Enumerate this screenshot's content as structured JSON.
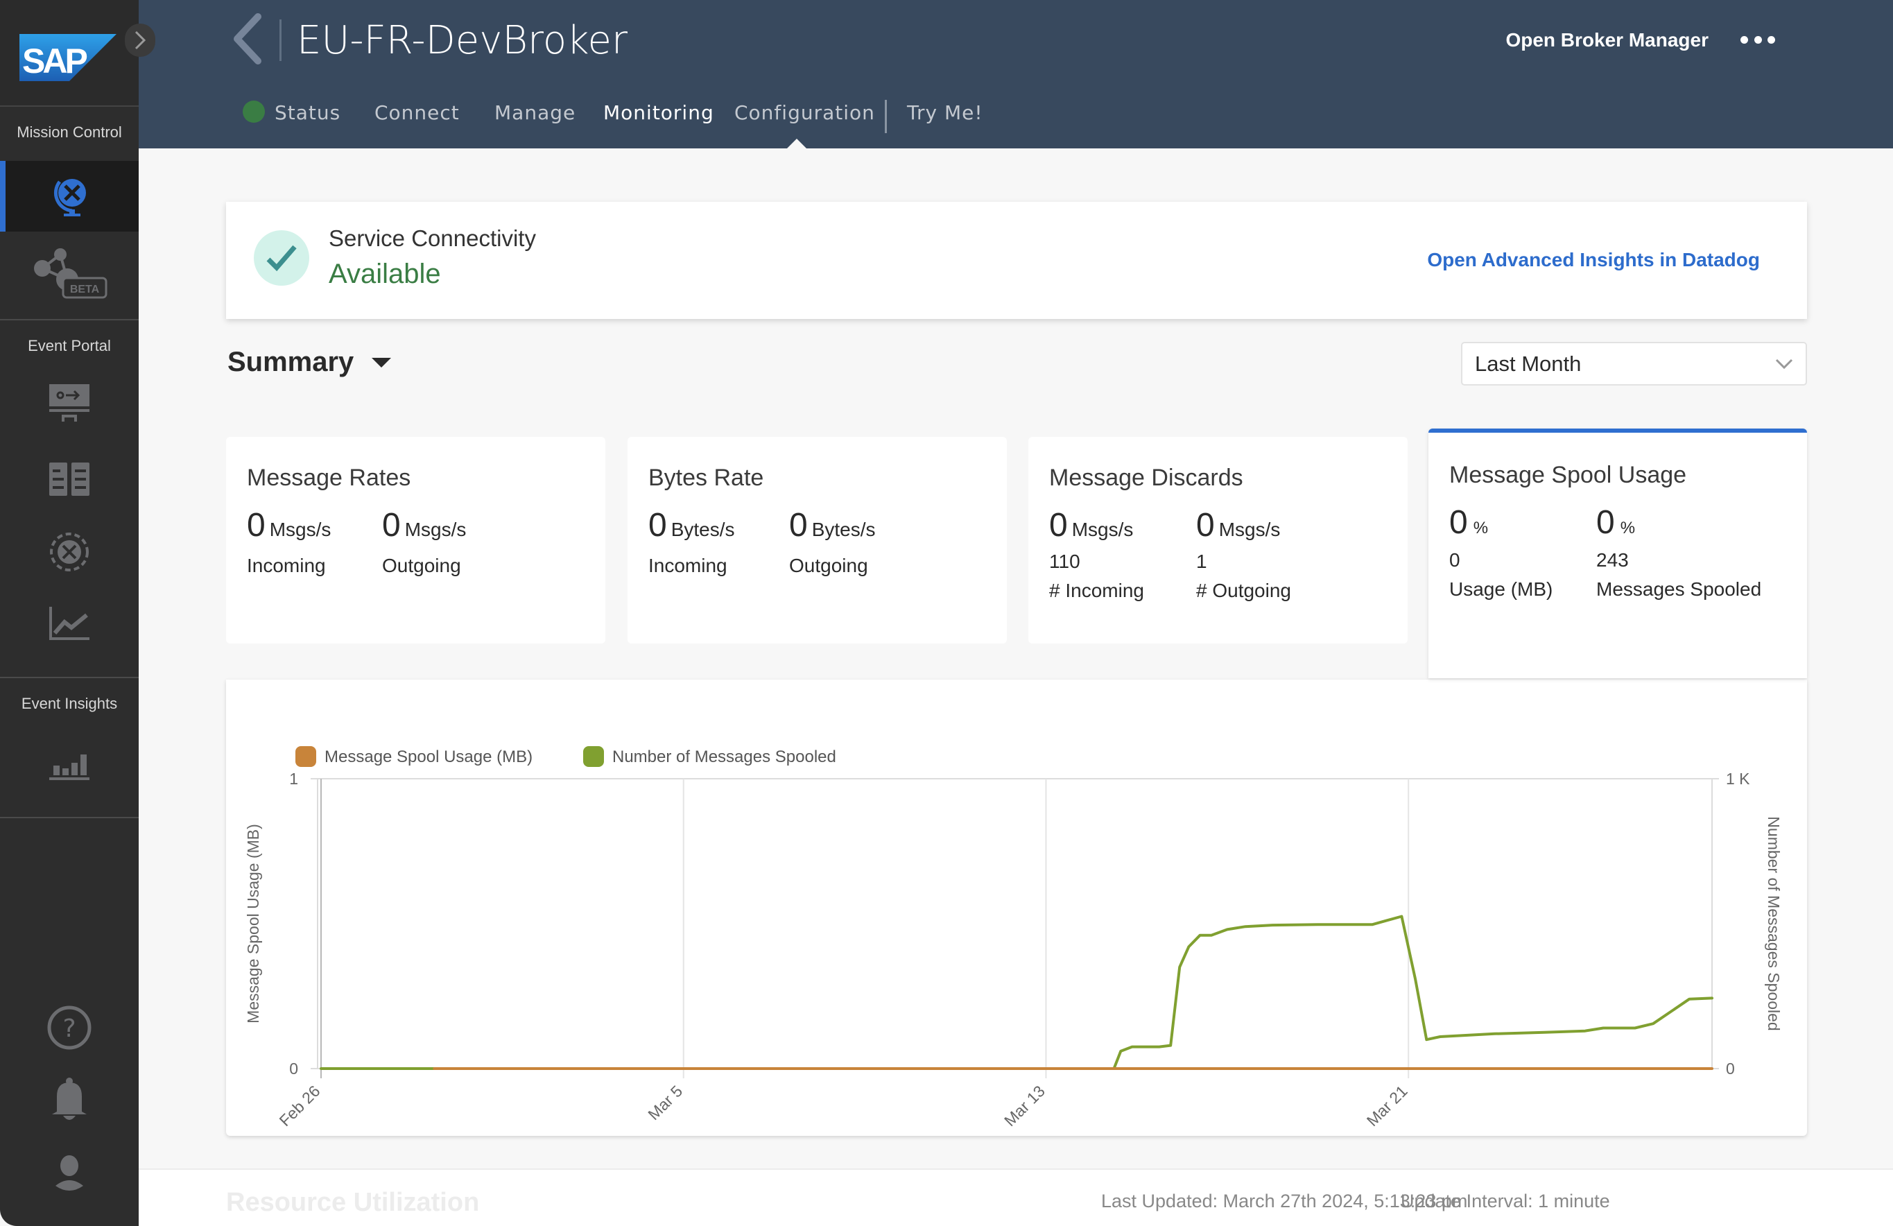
{
  "app": {
    "logo": "SAP",
    "expand_icon": "chevron-right-icon"
  },
  "sidebar": {
    "sections": [
      {
        "label": "Mission Control",
        "items": [
          {
            "name": "cluster-manager",
            "icon": "globe-icon",
            "active": true
          },
          {
            "name": "mesh-manager",
            "icon": "network-beta-icon",
            "badge": "BETA",
            "active": false
          }
        ]
      },
      {
        "label": "Event Portal",
        "items": [
          {
            "name": "designer",
            "icon": "designer-icon",
            "active": false
          },
          {
            "name": "catalog",
            "icon": "catalog-icon",
            "active": false
          },
          {
            "name": "runtime-event-manager",
            "icon": "runtime-globe-icon",
            "active": false
          },
          {
            "name": "event-portal-insights",
            "icon": "line-chart-icon",
            "active": false
          }
        ]
      },
      {
        "label": "Event Insights",
        "items": [
          {
            "name": "insights",
            "icon": "bar-chart-icon",
            "active": false
          }
        ]
      }
    ],
    "bottom": [
      {
        "name": "help",
        "icon": "help-icon"
      },
      {
        "name": "notifications",
        "icon": "bell-icon"
      },
      {
        "name": "user-profile",
        "icon": "user-icon"
      }
    ]
  },
  "header": {
    "title": "EU-FR-DevBroker",
    "open_broker_manager": "Open Broker Manager",
    "more_icon": "more-icon",
    "tabs": [
      {
        "label": "Status",
        "active": false,
        "status_color": "#3a7d44"
      },
      {
        "label": "Connect",
        "active": false
      },
      {
        "label": "Manage",
        "active": false
      },
      {
        "label": "Monitoring",
        "active": true
      },
      {
        "label": "Configuration",
        "active": false
      },
      {
        "label": "Try Me!",
        "active": false
      }
    ]
  },
  "connectivity": {
    "label": "Service Connectivity",
    "status": "Available",
    "status_color": "#3a7d44",
    "link": "Open Advanced Insights in Datadog"
  },
  "summary": {
    "title": "Summary",
    "range": "Last Month"
  },
  "cards": [
    {
      "title": "Message Rates",
      "cols": [
        {
          "value": "0",
          "unit": "Msgs/s",
          "label": "Incoming"
        },
        {
          "value": "0",
          "unit": "Msgs/s",
          "label": "Outgoing"
        }
      ]
    },
    {
      "title": "Bytes Rate",
      "cols": [
        {
          "value": "0",
          "unit": "Bytes/s",
          "label": "Incoming"
        },
        {
          "value": "0",
          "unit": "Bytes/s",
          "label": "Outgoing"
        }
      ]
    },
    {
      "title": "Message Discards",
      "cols": [
        {
          "value": "0",
          "unit": "Msgs/s",
          "count": "110",
          "label": "# Incoming"
        },
        {
          "value": "0",
          "unit": "Msgs/s",
          "count": "1",
          "label": "# Outgoing"
        }
      ]
    },
    {
      "title": "Message Spool Usage",
      "active": true,
      "cols": [
        {
          "value": "0",
          "unit": "%",
          "count": "0",
          "label": "Usage (MB)"
        },
        {
          "value": "0",
          "unit": "%",
          "count": "243",
          "label": "Messages Spooled"
        }
      ]
    }
  ],
  "chart_data": {
    "type": "line",
    "title": "",
    "legend": [
      {
        "name": "Message Spool Usage (MB)",
        "color": "#c8843a"
      },
      {
        "name": "Number of Messages Spooled",
        "color": "#80a030"
      }
    ],
    "legend_position": "top-left",
    "xlabel": "",
    "ylabel_left": "Message Spool Usage (MB)",
    "ylabel_right": "Number of Messages Spooled",
    "y_left": {
      "range": [
        0,
        1
      ],
      "ticks": [
        "0",
        "1"
      ]
    },
    "y_right": {
      "range": [
        0,
        1000
      ],
      "ticks": [
        "0",
        "1 K"
      ]
    },
    "x_range_days": [
      0,
      30.7
    ],
    "x_ticks": [
      {
        "label": "Feb 26",
        "day": 0
      },
      {
        "label": "Mar 5",
        "day": 8
      },
      {
        "label": "Mar 13",
        "day": 16
      },
      {
        "label": "Mar 21",
        "day": 24
      }
    ],
    "grid": true,
    "series": [
      {
        "name": "Message Spool Usage (MB)",
        "axis": "left",
        "points": [
          [
            2.5,
            0
          ],
          [
            30.7,
            0
          ]
        ]
      },
      {
        "name": "Number of Messages Spooled",
        "axis": "right",
        "points": [
          [
            0,
            0
          ],
          [
            16.0,
            0
          ],
          [
            17.5,
            0
          ],
          [
            17.65,
            60
          ],
          [
            17.9,
            75
          ],
          [
            18.5,
            75
          ],
          [
            18.75,
            80
          ],
          [
            18.95,
            350
          ],
          [
            19.15,
            420
          ],
          [
            19.4,
            460
          ],
          [
            19.65,
            460
          ],
          [
            20.0,
            480
          ],
          [
            20.4,
            490
          ],
          [
            21.0,
            495
          ],
          [
            22.0,
            497
          ],
          [
            23.2,
            497
          ],
          [
            23.5,
            510
          ],
          [
            23.85,
            525
          ],
          [
            24.15,
            310
          ],
          [
            24.4,
            100
          ],
          [
            24.7,
            110
          ],
          [
            25.3,
            115
          ],
          [
            25.9,
            120
          ],
          [
            27.0,
            125
          ],
          [
            27.9,
            130
          ],
          [
            28.3,
            140
          ],
          [
            29.0,
            140
          ],
          [
            29.4,
            155
          ],
          [
            30.2,
            240
          ],
          [
            30.7,
            243
          ]
        ]
      }
    ]
  },
  "footer": {
    "section": "Resource Utilization",
    "last_updated": "Last Updated: March 27th 2024, 5:13:23 pm",
    "update_interval": "Update Interval: 1 minute"
  }
}
